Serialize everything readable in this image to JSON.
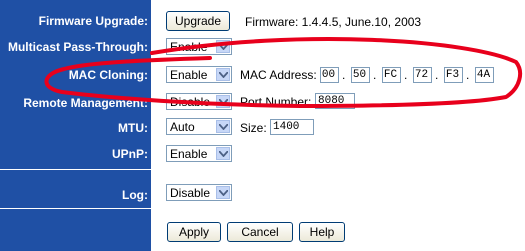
{
  "labels": {
    "firmware_upgrade": "Firmware Upgrade:",
    "multicast": "Multicast Pass-Through:",
    "mac_cloning": "MAC Cloning:",
    "remote_mgmt": "Remote Management:",
    "mtu": "MTU:",
    "upnp": "UPnP:",
    "log": "Log:"
  },
  "firmware": {
    "upgrade_button": "Upgrade",
    "version_text": "Firmware: 1.4.4.5, June.10, 2003"
  },
  "selects": {
    "multicast": "Enable",
    "mac_cloning": "Enable",
    "remote_mgmt": "Disable",
    "mtu": "Auto",
    "upnp": "Enable",
    "log": "Disable"
  },
  "mac": {
    "label": "MAC Address:",
    "octets": [
      "00",
      "50",
      "FC",
      "72",
      "F3",
      "4A"
    ],
    "separator": "."
  },
  "port": {
    "label": "Port Number:",
    "value": "8080"
  },
  "size": {
    "label": "Size:",
    "value": "1400"
  },
  "buttons": {
    "apply": "Apply",
    "cancel": "Cancel",
    "help": "Help"
  },
  "colors": {
    "sidebar": "#1f50a5",
    "annotation": "#e8001c"
  }
}
